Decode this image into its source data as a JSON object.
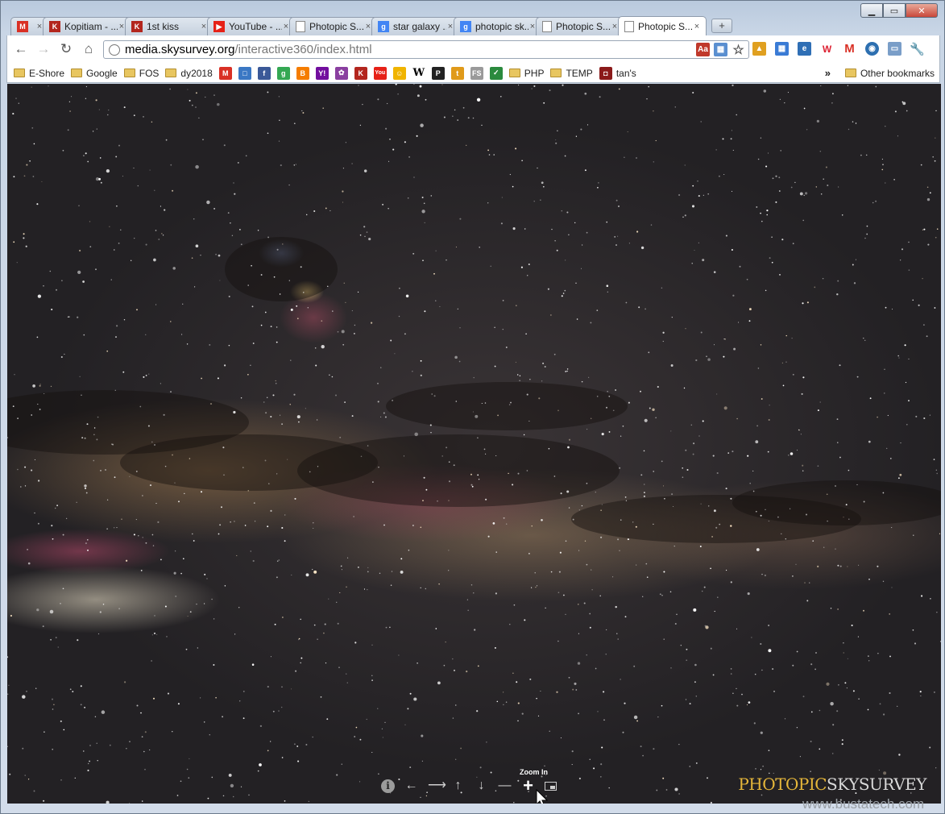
{
  "window": {
    "controls": [
      "minimize",
      "maximize",
      "close"
    ]
  },
  "tabs": [
    {
      "title": "",
      "icon": "gmail-icon",
      "color": "#d93025"
    },
    {
      "title": "Kopitiam - ...",
      "icon": "kopitiam-icon",
      "color": "#b3261e"
    },
    {
      "title": "1st kiss",
      "icon": "kopitiam-icon",
      "color": "#b3261e"
    },
    {
      "title": "YouTube - ...",
      "icon": "youtube-icon",
      "color": "#e62117"
    },
    {
      "title": "Photopic S...",
      "icon": "page-icon",
      "color": "#888888"
    },
    {
      "title": "star galaxy ...",
      "icon": "google-icon",
      "color": "#4285f4"
    },
    {
      "title": "photopic sk...",
      "icon": "google-icon",
      "color": "#4285f4"
    },
    {
      "title": "Photopic S...",
      "icon": "page-icon",
      "color": "#888888"
    },
    {
      "title": "Photopic S...",
      "icon": "page-icon",
      "color": "#888888",
      "active": true
    }
  ],
  "omnibox": {
    "host": "media.skysurvey.org",
    "path": "/interactive360/index.html"
  },
  "bookmarks": [
    {
      "type": "folder",
      "label": "E-Shore"
    },
    {
      "type": "folder",
      "label": "Google"
    },
    {
      "type": "folder",
      "label": "FOS"
    },
    {
      "type": "folder",
      "label": "dy2018"
    },
    {
      "type": "icon",
      "name": "gmail-icon",
      "color": "#d93025",
      "glyph": "M"
    },
    {
      "type": "icon",
      "name": "page-icon",
      "color": "#3b78c4",
      "glyph": "□"
    },
    {
      "type": "icon",
      "name": "facebook-icon",
      "color": "#3b5998",
      "glyph": "f"
    },
    {
      "type": "icon",
      "name": "google-icon",
      "color": "#34a853",
      "glyph": "g"
    },
    {
      "type": "icon",
      "name": "blogger-icon",
      "color": "#f57d00",
      "glyph": "B"
    },
    {
      "type": "icon",
      "name": "yahoo-icon",
      "color": "#720e9e",
      "glyph": "Y!"
    },
    {
      "type": "icon",
      "name": "flower-icon",
      "color": "#8a3fa0",
      "glyph": "✿"
    },
    {
      "type": "icon",
      "name": "kopitiam-icon",
      "color": "#b3261e",
      "glyph": "K"
    },
    {
      "type": "icon",
      "name": "youtube-icon",
      "color": "#e62117",
      "glyph": "You"
    },
    {
      "type": "icon",
      "name": "smiley-icon",
      "color": "#f0b400",
      "glyph": "☺"
    },
    {
      "type": "icon",
      "name": "wikipedia-icon",
      "color": "#ffffff",
      "glyph": "W"
    },
    {
      "type": "icon",
      "name": "python-icon",
      "color": "#222222",
      "glyph": "P"
    },
    {
      "type": "icon",
      "name": "tool-icon",
      "color": "#e09a1a",
      "glyph": "t"
    },
    {
      "type": "icon",
      "name": "fs-icon",
      "color": "#9a9a9a",
      "glyph": "FS"
    },
    {
      "type": "icon",
      "name": "check-icon",
      "color": "#2b8a3e",
      "glyph": "✓"
    },
    {
      "type": "folder",
      "label": "PHP"
    },
    {
      "type": "folder",
      "label": "TEMP"
    },
    {
      "type": "iconlabel",
      "name": "tans-icon",
      "color": "#8b1a1a",
      "glyph": "◘",
      "label": "tan's"
    }
  ],
  "bookmarks_more": "»",
  "other_bookmarks": "Other bookmarks",
  "viewer": {
    "tooltip": "Zoom In",
    "controls": [
      {
        "name": "info-button",
        "glyph": "i"
      },
      {
        "name": "pan-left-button",
        "glyph": "←"
      },
      {
        "name": "pan-right-button",
        "glyph": "⟶"
      },
      {
        "name": "pan-up-button",
        "glyph": "↑"
      },
      {
        "name": "pan-down-button",
        "glyph": "↓"
      },
      {
        "name": "zoom-out-button",
        "glyph": "—"
      },
      {
        "name": "zoom-in-button",
        "glyph": "+"
      },
      {
        "name": "fullscreen-button",
        "glyph": ""
      }
    ],
    "brand_part1": "PHOTOPIC",
    "brand_part2": "SKYSURVEY"
  },
  "watermark": "www.bustatech.com"
}
